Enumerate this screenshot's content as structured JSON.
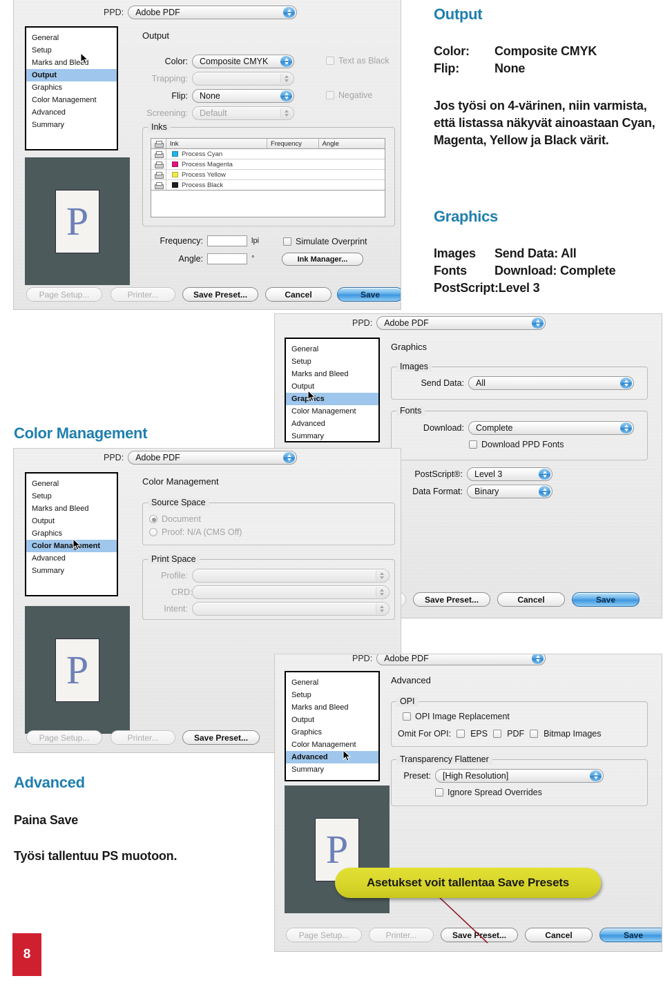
{
  "page": {
    "number": "8"
  },
  "annotations": {
    "output": {
      "heading": "Output",
      "rows": [
        {
          "key": "Color:",
          "value": "Composite CMYK"
        },
        {
          "key": "Flip:",
          "value": "None"
        }
      ],
      "note_line1": "Jos työsi on 4-värinen, niin varmista,",
      "note_line2": "että listassa näkyvät ainoastaan Cyan,",
      "note_line3": "Magenta, Yellow ja Black värit."
    },
    "graphics": {
      "heading": "Graphics",
      "rows": [
        {
          "key": "Images",
          "value": "Send Data: All"
        },
        {
          "key": "Fonts",
          "value": "Download: Complete"
        }
      ],
      "postscript": "PostScript:Level 3"
    },
    "color_management": {
      "heading": "Color Management"
    },
    "advanced": {
      "heading": "Advanced",
      "line1": "Paina Save",
      "line2": "Työsi tallentuu PS muotoon."
    },
    "callout": {
      "text": "Asetukset voit tallentaa Save Presets"
    }
  },
  "nav": {
    "items": [
      "General",
      "Setup",
      "Marks and Bleed",
      "Output",
      "Graphics",
      "Color Management",
      "Advanced",
      "Summary"
    ]
  },
  "common": {
    "ppd_label": "PPD:",
    "ppd_value": "Adobe PDF",
    "buttons": {
      "page_setup": "Page Setup...",
      "printer": "Printer...",
      "save_preset": "Save Preset...",
      "cancel": "Cancel",
      "save": "Save"
    },
    "preview_letter": "P"
  },
  "shot_output": {
    "panel_title": "Output",
    "selected_nav": "Output",
    "fields": [
      {
        "label": "Color:",
        "value": "Composite CMYK",
        "enabled": true
      },
      {
        "label": "Trapping:",
        "value": "",
        "enabled": false
      },
      {
        "label": "Flip:",
        "value": "None",
        "enabled": true
      },
      {
        "label": "Screening:",
        "value": "Default",
        "enabled": false
      }
    ],
    "checkboxes": [
      {
        "label": "Text as Black"
      },
      {
        "label": "Negative"
      }
    ],
    "inks_group": "Inks",
    "inks_columns": [
      "Ink",
      "Frequency",
      "Angle"
    ],
    "inks_rows": [
      {
        "name": "Process Cyan",
        "color": "#22b4e8"
      },
      {
        "name": "Process Magenta",
        "color": "#e0157f"
      },
      {
        "name": "Process Yellow",
        "color": "#f2ea4c"
      },
      {
        "name": "Process Black",
        "color": "#1e1e1e"
      }
    ],
    "frequency_label": "Frequency:",
    "frequency_value": "",
    "frequency_unit": "lpi",
    "angle_label": "Angle:",
    "angle_value": "",
    "angle_unit": "°",
    "simulate_overprint": "Simulate Overprint",
    "ink_manager": "Ink Manager..."
  },
  "shot_graphics": {
    "panel_title": "Graphics",
    "selected_nav": "Graphics",
    "images_group": "Images",
    "send_data_label": "Send Data:",
    "send_data_value": "All",
    "fonts_group": "Fonts",
    "download_label": "Download:",
    "download_value": "Complete",
    "download_ppd_fonts": "Download PPD Fonts",
    "postscript_label": "PostScript®:",
    "postscript_value": "Level 3",
    "data_format_label": "Data Format:",
    "data_format_value": "Binary"
  },
  "shot_color_management": {
    "panel_title": "Color Management",
    "selected_nav": "Color Management",
    "source_space_group": "Source Space",
    "source_document": "Document",
    "source_proof": "Proof:  N/A (CMS Off)",
    "print_space_group": "Print Space",
    "print_fields": [
      {
        "label": "Profile:",
        "value": ""
      },
      {
        "label": "CRD:",
        "value": ""
      },
      {
        "label": "Intent:",
        "value": ""
      }
    ]
  },
  "shot_advanced": {
    "panel_title": "Advanced",
    "selected_nav": "Advanced",
    "opi_group": "OPI",
    "opi_image_replacement": "OPI Image Replacement",
    "omit_for_opi_label": "Omit For OPI:",
    "omit_options": [
      "EPS",
      "PDF",
      "Bitmap Images"
    ],
    "flattener_group": "Transparency Flattener",
    "preset_label": "Preset:",
    "preset_value": "[High Resolution]",
    "ignore_spread_overrides": "Ignore Spread Overrides"
  }
}
